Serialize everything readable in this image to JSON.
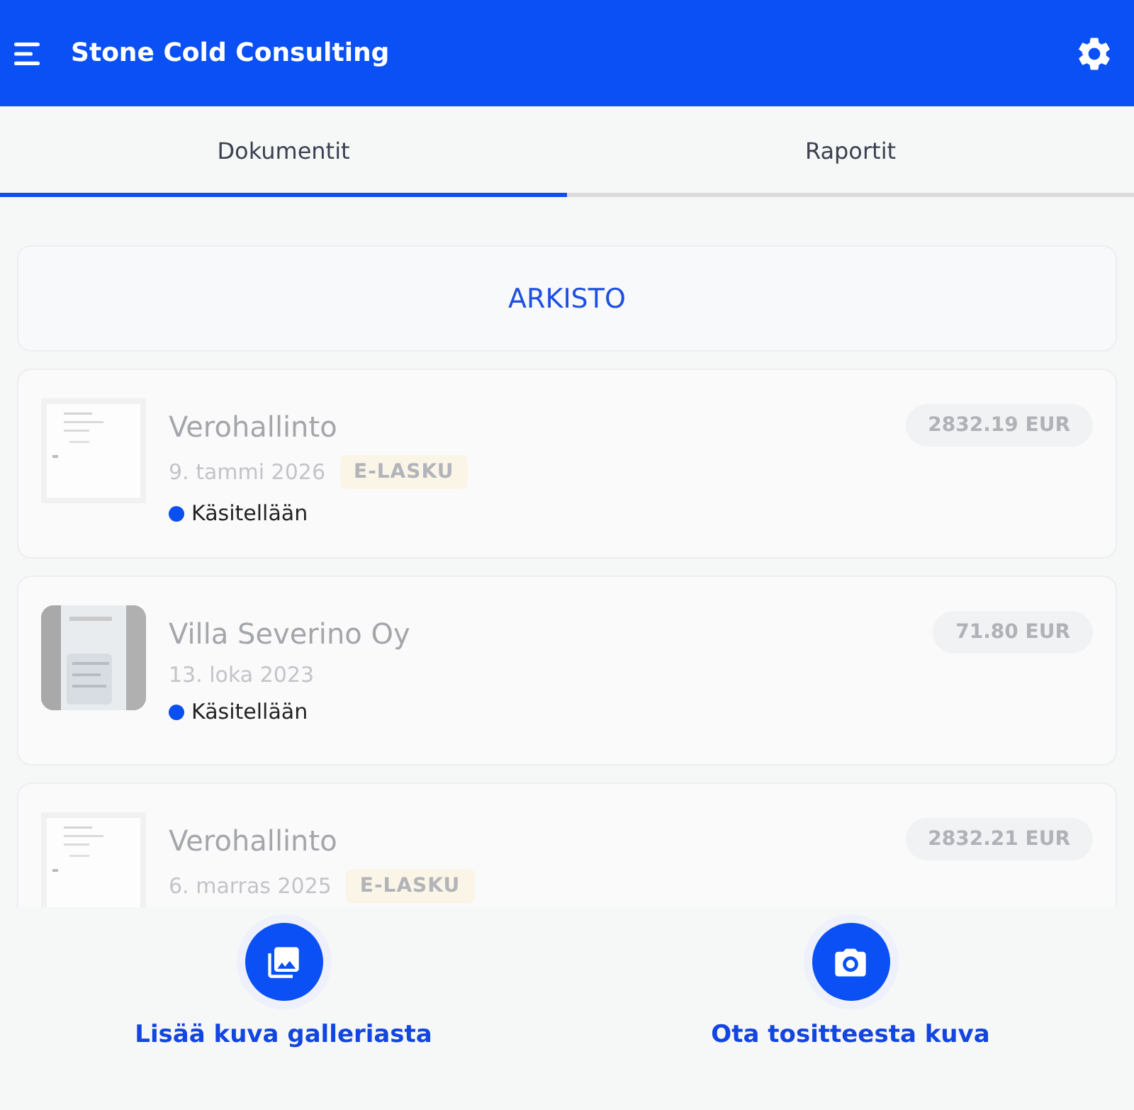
{
  "app_bar": {
    "title": "Stone Cold Consulting"
  },
  "tabs": [
    {
      "label": "Dokumentit",
      "selected": true
    },
    {
      "label": "Raportit",
      "selected": false
    }
  ],
  "archive_button": "ARKISTO",
  "documents": [
    {
      "kind": "scan",
      "name": "Verohallinto",
      "date": "9. tammi 2026",
      "badge": "E-LASKU",
      "status": "Käsitellään",
      "color": "#0a4ff0",
      "amount": "2832.19 EUR"
    },
    {
      "name": "Villa Severino Oy",
      "date": "13. loka 2023",
      "status": "Käsitellään",
      "color": "#0a4ff0",
      "amount": "71.80 EUR"
    },
    {
      "kind": "scan",
      "name": "Verohallinto",
      "date": "6. marras 2025",
      "badge": "E-LASKU",
      "amount": "2832.21 EUR"
    }
  ],
  "actions": [
    {
      "kind": "gallery",
      "label": "Lisää kuva galleriasta"
    },
    {
      "kind": "camera",
      "label": "Ota tositteesta kuva"
    }
  ]
}
